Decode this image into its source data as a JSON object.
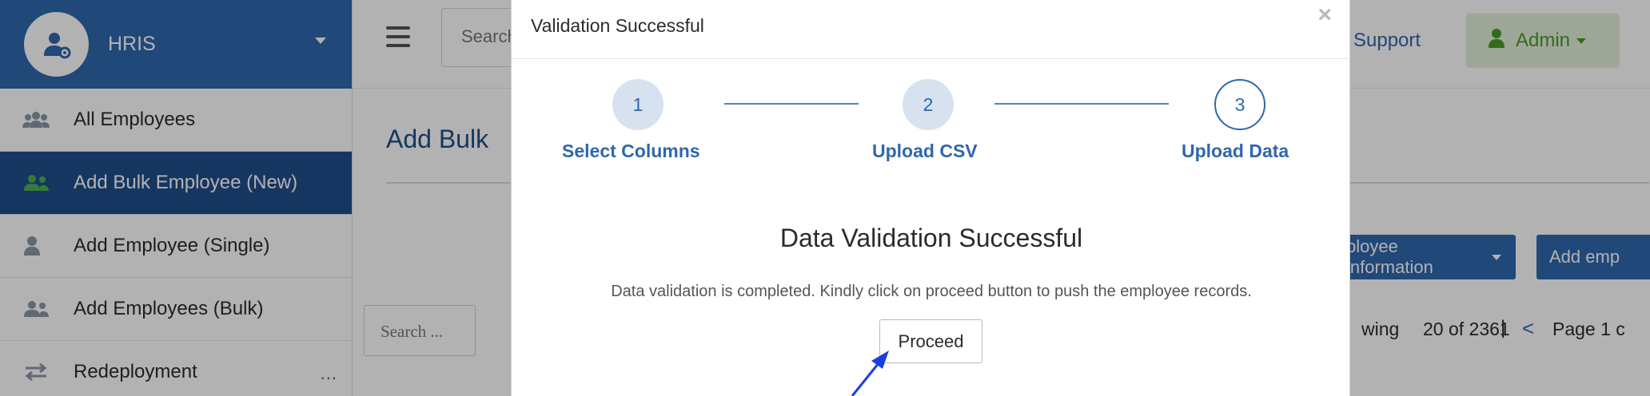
{
  "sidebar": {
    "brand_title": "HRIS",
    "items": [
      {
        "label": "All Employees"
      },
      {
        "label": "Add Bulk Employee (New)"
      },
      {
        "label": "Add Employee (Single)"
      },
      {
        "label": "Add Employees (Bulk)"
      },
      {
        "label": "Redeployment"
      }
    ],
    "more_label": "..."
  },
  "topbar": {
    "search_placeholder": "Search",
    "support_label": "Support",
    "admin_label": "Admin"
  },
  "page": {
    "title": "Add Bulk",
    "employee_info_button": "ployee information",
    "add_employee_button": "Add emp",
    "search_placeholder": "Search ...",
    "showing_prefix": "wing",
    "showing_count": "20 of 2361",
    "pipe": "|",
    "prev_arrow": "<",
    "page_label": "Page 1 c"
  },
  "modal": {
    "title": "Validation Successful",
    "close_glyph": "×",
    "steps": [
      {
        "number": "1",
        "label": "Select Columns",
        "state": "done"
      },
      {
        "number": "2",
        "label": "Upload CSV",
        "state": "done"
      },
      {
        "number": "3",
        "label": "Upload Data",
        "state": "current"
      }
    ],
    "heading": "Data Validation Successful",
    "description": "Data validation is completed. Kindly click on proceed button to push the employee records.",
    "proceed_label": "Proceed"
  },
  "colors": {
    "brand_blue": "#2f67ad",
    "active_nav": "#1f4e8c",
    "admin_green": "#4a9a2a",
    "annotation_arrow": "#1a3fe0"
  },
  "icons": {
    "brand": "user-gear-icon",
    "nav": [
      "users-icon",
      "user-plus-icon",
      "user-icon",
      "users-icon",
      "exchange-icon"
    ],
    "admin": "user-icon",
    "menu": "hamburger-icon"
  }
}
